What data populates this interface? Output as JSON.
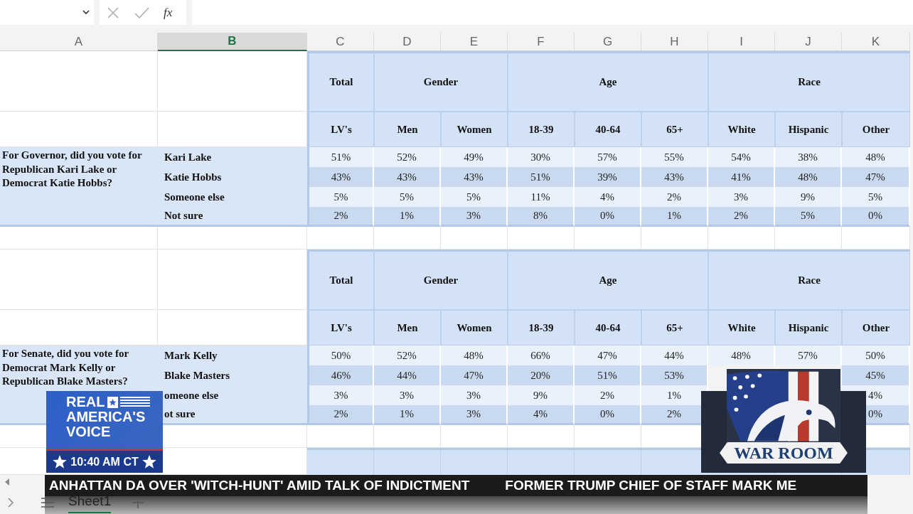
{
  "formula_bar": {
    "function_label": "fx"
  },
  "column_headers": [
    {
      "label": "A",
      "selected": false
    },
    {
      "label": "B",
      "selected": true
    },
    {
      "label": "C",
      "selected": false
    },
    {
      "label": "D",
      "selected": false
    },
    {
      "label": "E",
      "selected": false
    },
    {
      "label": "F",
      "selected": false
    },
    {
      "label": "G",
      "selected": false
    },
    {
      "label": "H",
      "selected": false
    },
    {
      "label": "I",
      "selected": false
    },
    {
      "label": "J",
      "selected": false
    },
    {
      "label": "K",
      "selected": false
    }
  ],
  "blocks": [
    {
      "groups": [
        {
          "label": "Total",
          "columns": [
            "LV's"
          ]
        },
        {
          "label": "Gender",
          "columns": [
            "Men",
            "Women"
          ]
        },
        {
          "label": "Age",
          "columns": [
            "18-39",
            "40-64",
            "65+"
          ]
        },
        {
          "label": "Race",
          "columns": [
            "White",
            "Hispanic",
            "Other"
          ]
        }
      ],
      "question": "For Governor, did you vote for Republican Kari Lake or Democrat Katie Hobbs?",
      "rows": [
        {
          "answer": "Kari Lake",
          "values": [
            "51%",
            "52%",
            "49%",
            "30%",
            "57%",
            "55%",
            "54%",
            "38%",
            "48%"
          ]
        },
        {
          "answer": "Katie Hobbs",
          "values": [
            "43%",
            "43%",
            "43%",
            "51%",
            "39%",
            "43%",
            "41%",
            "48%",
            "47%"
          ]
        },
        {
          "answer": "Someone else",
          "values": [
            "5%",
            "5%",
            "5%",
            "11%",
            "4%",
            "2%",
            "3%",
            "9%",
            "5%"
          ]
        },
        {
          "answer": "Not sure",
          "values": [
            "2%",
            "1%",
            "3%",
            "8%",
            "0%",
            "1%",
            "2%",
            "5%",
            "0%"
          ]
        }
      ]
    },
    {
      "groups": [
        {
          "label": "Total",
          "columns": [
            "LV's"
          ]
        },
        {
          "label": "Gender",
          "columns": [
            "Men",
            "Women"
          ]
        },
        {
          "label": "Age",
          "columns": [
            "18-39",
            "40-64",
            "65+"
          ]
        },
        {
          "label": "Race",
          "columns": [
            "White",
            "Hispanic",
            "Other"
          ]
        }
      ],
      "question": "For Senate, did you vote for Democrat Mark Kelly or Republican Blake Masters?",
      "rows": [
        {
          "answer": "Mark Kelly",
          "values": [
            "50%",
            "52%",
            "48%",
            "66%",
            "47%",
            "44%",
            "48%",
            "57%",
            "50%"
          ]
        },
        {
          "answer": "Blake Masters",
          "values": {
            "C": "46%",
            "D": "44%",
            "E": "47%",
            "F": "20%",
            "G": "51%",
            "H": "53%",
            "K": "45%"
          }
        },
        {
          "answer": "omeone else",
          "values": {
            "C": "3%",
            "D": "3%",
            "E": "3%",
            "F": "9%",
            "G": "2%",
            "H": "1%",
            "K": "4%"
          }
        },
        {
          "answer": "ot sure",
          "values": {
            "C": "2%",
            "D": "1%",
            "E": "3%",
            "F": "4%",
            "G": "0%",
            "H": "2%",
            "K": "0%"
          }
        }
      ]
    }
  ],
  "sheet_tabs": [
    {
      "label": "Sheet1",
      "selected": true
    }
  ],
  "channel_logo": {
    "lines": [
      "REAL",
      "AMERICA'S",
      "VOICE"
    ],
    "time": "10:40 AM CT"
  },
  "show_logo": {
    "title": "WAR ROOM"
  },
  "ticker": [
    "ANHATTAN DA OVER 'WITCH-HUNT' AMID TALK OF INDICTMENT",
    "FORMER TRUMP CHIEF OF STAFF MARK ME"
  ]
}
